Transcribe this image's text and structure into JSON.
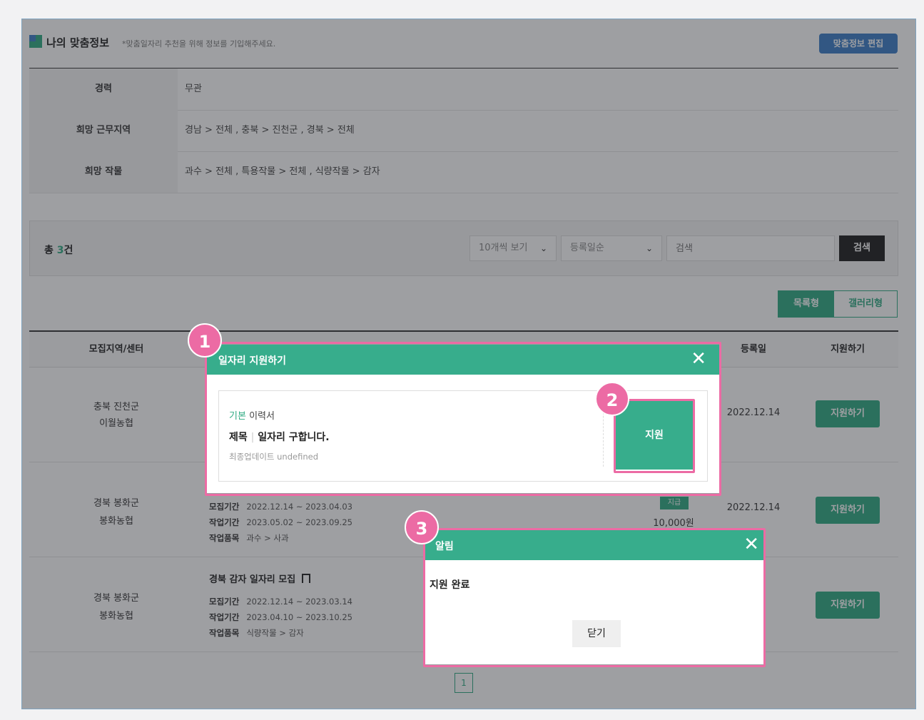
{
  "header": {
    "title": "나의 맞춤정보",
    "note": "*맞춤일자리 추천을 위해 정보를 기입해주세요.",
    "edit_button": "맞춤정보 편집"
  },
  "info": {
    "career_label": "경력",
    "career_value": "무관",
    "region_label": "희망 근무지역",
    "region_value": "경남 > 전체 , 충북 > 진천군 , 경북 > 전체",
    "crop_label": "희망 작물",
    "crop_value": "과수 > 전체 , 특용작물 > 전체 , 식량작물 > 감자"
  },
  "search": {
    "total_prefix": "총 ",
    "total_count": "3",
    "total_suffix": "건",
    "per_page": "10개씩 보기",
    "sort": "등록일순",
    "placeholder": "검색",
    "button": "검색"
  },
  "view": {
    "list": "목록형",
    "gallery": "갤러리형"
  },
  "table": {
    "headers": {
      "region": "모집지역/센터",
      "date": "등록일",
      "apply": "지원하기"
    },
    "rows": [
      {
        "region": "충북 진천군",
        "center": "이월농협",
        "date": "2022.12.14",
        "apply": "지원하기"
      },
      {
        "region": "경북 봉화군",
        "center": "봉화농협",
        "recruit_label": "모집기간",
        "recruit": "2022.12.14 ~ 2023.04.03",
        "work_label": "작업기간",
        "work": "2023.05.02 ~ 2023.09.25",
        "item_label": "작업품목",
        "item": "과수 > 사과",
        "pay": "10,000원",
        "tag": "지급",
        "date": "2022.12.14",
        "apply": "지원하기"
      },
      {
        "region": "경북 봉화군",
        "center": "봉화농협",
        "title": "경북 감자 일자리 모집",
        "recruit_label": "모집기간",
        "recruit": "2022.12.14 ~ 2023.03.14",
        "work_label": "작업기간",
        "work": "2023.04.10 ~ 2023.10.25",
        "item_label": "작업품목",
        "item": "식량작물 > 감자",
        "date_partial": ".14",
        "apply": "지원하기"
      }
    ]
  },
  "pagination": {
    "current": "1"
  },
  "apply_modal": {
    "title": "일자리 지원하기",
    "resume_type": "기본",
    "resume_word": "이력서",
    "subject_label": "제목",
    "subject": "일자리 구합니다.",
    "updated_label": "최종업데이트",
    "updated_value": "undefined",
    "apply_button": "지원"
  },
  "alert_modal": {
    "title": "알림",
    "message": "지원 완료",
    "close_button": "닫기"
  },
  "callouts": {
    "one": "1",
    "two": "2",
    "three": "3"
  },
  "colors": {
    "accent": "#37ad8c",
    "edit_button": "#3b7dc7",
    "highlight": "#ec6ba4"
  }
}
